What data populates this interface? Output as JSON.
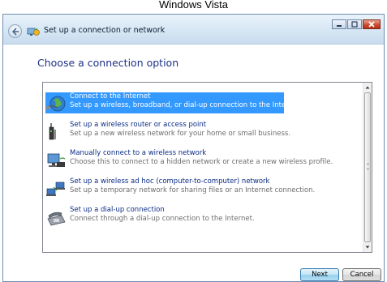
{
  "caption": "Windows Vista",
  "window": {
    "title": "Set up a connection or network"
  },
  "heading": "Choose a connection option",
  "options": [
    {
      "title": "Connect to the Internet",
      "description": "Set up a wireless, broadband, or dial-up connection to the Internet.",
      "icon": "globe-icon",
      "selected": true
    },
    {
      "title": "Set up a wireless router or access point",
      "description": "Set up a new wireless network for your home or small business.",
      "icon": "router-icon",
      "selected": false
    },
    {
      "title": "Manually connect to a wireless network",
      "description": "Choose this to connect to a hidden network or create a new wireless profile.",
      "icon": "wireless-computer-icon",
      "selected": false
    },
    {
      "title": "Set up a wireless ad hoc (computer-to-computer) network",
      "description": "Set up a temporary network for sharing files or an Internet connection.",
      "icon": "adhoc-network-icon",
      "selected": false
    },
    {
      "title": "Set up a dial-up connection",
      "description": "Connect through a dial-up connection to the Internet.",
      "icon": "dialup-phone-icon",
      "selected": false
    }
  ],
  "buttons": {
    "next": "Next",
    "cancel": "Cancel"
  },
  "colors": {
    "selection": "#3399ff",
    "heading": "#1e3287",
    "option_title": "#0c2c84"
  }
}
